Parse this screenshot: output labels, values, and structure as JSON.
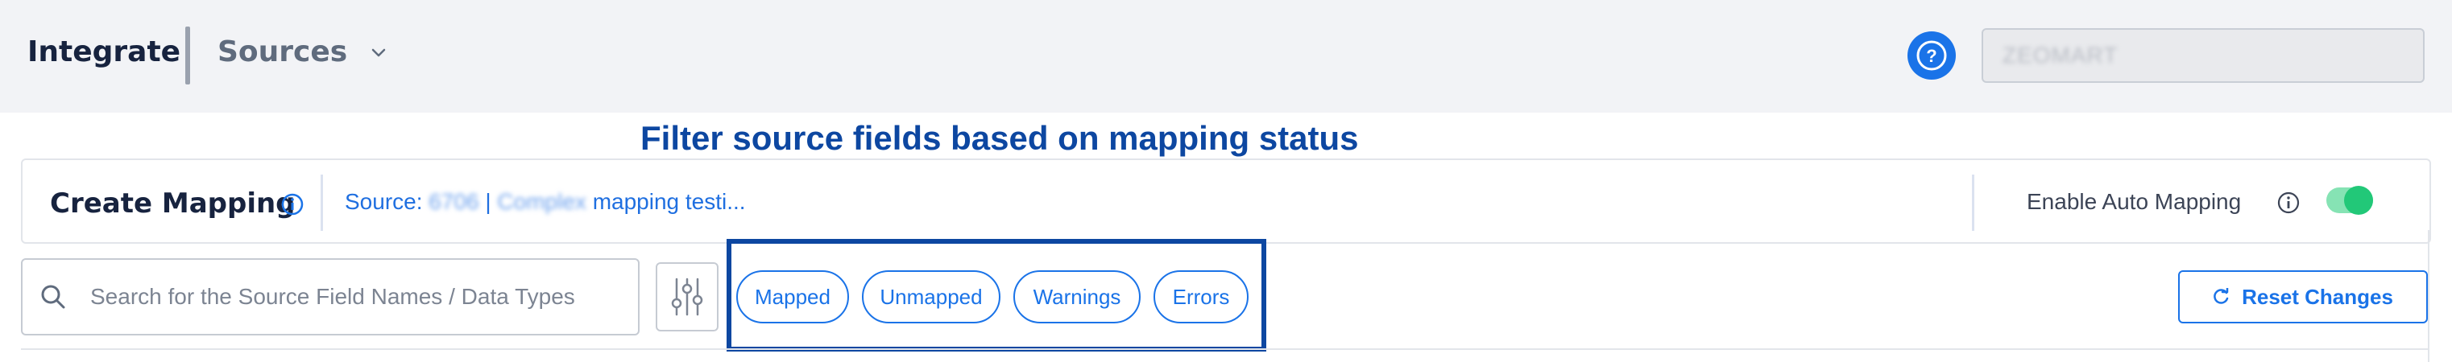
{
  "header": {
    "brand": "Integrate",
    "section": "Sources",
    "account_placeholder": "ZEOMART"
  },
  "annotation": {
    "title": "Filter source fields based on mapping status"
  },
  "card": {
    "title": "Create Mapping",
    "source_prefix": "Source:",
    "source_id": "6706",
    "source_separator": "|",
    "source_type": "Complex",
    "source_name": "mapping testi...",
    "auto_mapping_label": "Enable Auto Mapping",
    "auto_mapping_enabled": true
  },
  "toolbar": {
    "search_placeholder": "Search for the Source Field Names / Data Types",
    "filters": [
      "Mapped",
      "Unmapped",
      "Warnings",
      "Errors"
    ],
    "reset_label": "Reset Changes"
  },
  "colors": {
    "accent": "#1a73e8",
    "annotation": "#0d47a1",
    "toggle_on": "#22c878",
    "topbar_bg": "#f2f3f6"
  },
  "icons": {
    "help": "help-icon",
    "info": "info-icon",
    "search": "search-icon",
    "filter": "sliders-icon",
    "reset": "refresh-icon",
    "dropdown": "chevron-down-icon"
  }
}
